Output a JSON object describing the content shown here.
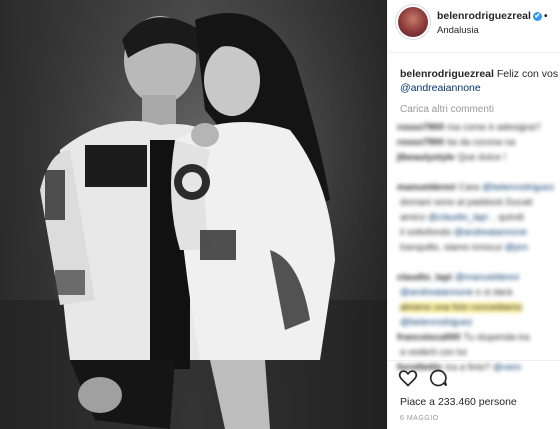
{
  "post": {
    "username": "belenrodriguezreal",
    "verified_mark": "✔",
    "more_dot": "•",
    "location": "Andalusia",
    "caption_user": "belenrodriguezreal",
    "caption_text": "Feliz con vos",
    "caption_mention": "@andreaiannone",
    "load_more": "Carica altri commenti",
    "likes": "Piace a 233.460 persone",
    "date": "6 MAGGIO"
  },
  "comments": [
    {
      "user": "rosso7900",
      "text": "ma come è adesigna?"
    },
    {
      "user": "rosso7900",
      "text": "tia da corona na"
    },
    {
      "user": "jlbeautystyle",
      "text": "Que dulce !"
    },
    {
      "user": "",
      "text": ""
    },
    {
      "user": "manueldenni",
      "text": "Cara ",
      "mention": "@belenrodriguez"
    },
    {
      "user": "",
      "text": "domani sono al paddock Ducati"
    },
    {
      "user": "",
      "text": "amico ",
      "mention": "@claudio_lapi",
      "tail": " .. quindi"
    },
    {
      "user": "",
      "text": "il sottofondo ",
      "mention": "@andreaiannone"
    },
    {
      "user": "",
      "text": "tranquillo, siamo innocui ",
      "mention": "@pro"
    },
    {
      "user": "",
      "text": ""
    },
    {
      "user": "claudio_lapi",
      "text": "",
      "mention": "@manueldenni"
    },
    {
      "user": "",
      "text": "",
      "mention": "@andreaiannone",
      "tail": " o si darà"
    },
    {
      "user": "",
      "text": "",
      "highlight": "almeno una foto concediamo"
    },
    {
      "user": "",
      "text": "",
      "mention": "@belenrodriguez"
    },
    {
      "user": "francoisca000",
      "text": "Tu stupenda tra"
    },
    {
      "user": "",
      "text": "a vederti con lui"
    },
    {
      "user": "fornillettic",
      "text": "tra a finio? ",
      "mention": "@vero"
    }
  ],
  "icons": {
    "like": "heart-outline-icon",
    "comment": "speech-bubble-icon"
  },
  "colors": {
    "link": "#003569",
    "verified": "#3897f0",
    "muted": "#999999",
    "text": "#262626"
  }
}
